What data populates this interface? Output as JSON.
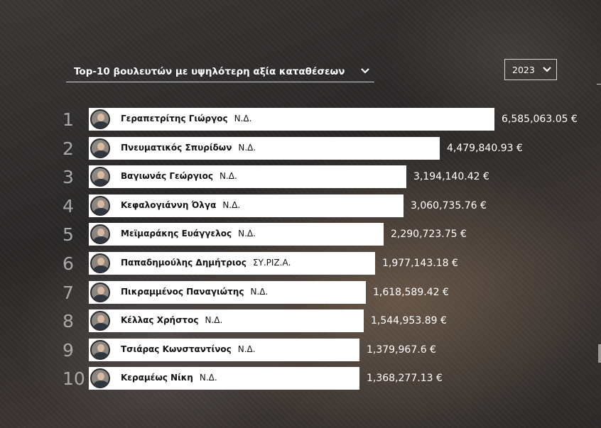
{
  "header": {
    "title": "Top-10 βουλευτών με υψηλότερη αξία καταθέσεων",
    "year": "2023"
  },
  "colors": {
    "bar": "#ffffff",
    "rank": "#a9a9a9",
    "value": "#ffffff"
  },
  "chart_data": {
    "type": "bar",
    "title": "Top-10 βουλευτών με υψηλότερη αξία καταθέσεων",
    "unit": "€",
    "categories": [
      "Γεραπετρίτης Γιώργος",
      "Πνευματικός Σπυρίδων",
      "Βαγιωνάς Γεώργιος",
      "Κεφαλογιάννη Όλγα",
      "Μεϊμαράκης Ευάγγελος",
      "Παπαδημούλης Δημήτριος",
      "Πικραμμένος Παναγιώτης",
      "Κέλλας Χρήστος",
      "Τσιάρας Κωνσταντίνος",
      "Κεραμέως Νίκη"
    ],
    "values": [
      6585063.05,
      4479840.93,
      3194140.42,
      3060735.76,
      2290723.75,
      1977143.18,
      1618589.42,
      1544953.89,
      1379967.6,
      1368277.13
    ],
    "rows": [
      {
        "rank": "1",
        "name": "Γεραπετρίτης Γιώργος",
        "party": "Ν.Δ.",
        "value": 6585063.05,
        "value_label": "6,585,063.05 €"
      },
      {
        "rank": "2",
        "name": "Πνευματικός Σπυρίδων",
        "party": "Ν.Δ.",
        "value": 4479840.93,
        "value_label": "4,479,840.93 €"
      },
      {
        "rank": "3",
        "name": "Βαγιωνάς Γεώργιος",
        "party": "Ν.Δ.",
        "value": 3194140.42,
        "value_label": "3,194,140.42 €"
      },
      {
        "rank": "4",
        "name": "Κεφαλογιάννη Όλγα",
        "party": "Ν.Δ.",
        "value": 3060735.76,
        "value_label": "3,060,735.76 €"
      },
      {
        "rank": "5",
        "name": "Μεϊμαράκης Ευάγγελος",
        "party": "Ν.Δ.",
        "value": 2290723.75,
        "value_label": "2,290,723.75 €"
      },
      {
        "rank": "6",
        "name": "Παπαδημούλης Δημήτριος",
        "party": "ΣΥ.ΡΙΖ.Α.",
        "value": 1977143.18,
        "value_label": "1,977,143.18 €"
      },
      {
        "rank": "7",
        "name": "Πικραμμένος Παναγιώτης",
        "party": "Ν.Δ.",
        "value": 1618589.42,
        "value_label": "1,618,589.42 €"
      },
      {
        "rank": "8",
        "name": "Κέλλας Χρήστος",
        "party": "Ν.Δ.",
        "value": 1544953.89,
        "value_label": "1,544,953.89 €"
      },
      {
        "rank": "9",
        "name": "Τσιάρας Κωνσταντίνος",
        "party": "Ν.Δ.",
        "value": 1379967.6,
        "value_label": "1,379,967.6 €"
      },
      {
        "rank": "10",
        "name": "Κεραμέως Νίκη",
        "party": "Ν.Δ.",
        "value": 1368277.13,
        "value_label": "1,368,277.13 €"
      }
    ]
  }
}
